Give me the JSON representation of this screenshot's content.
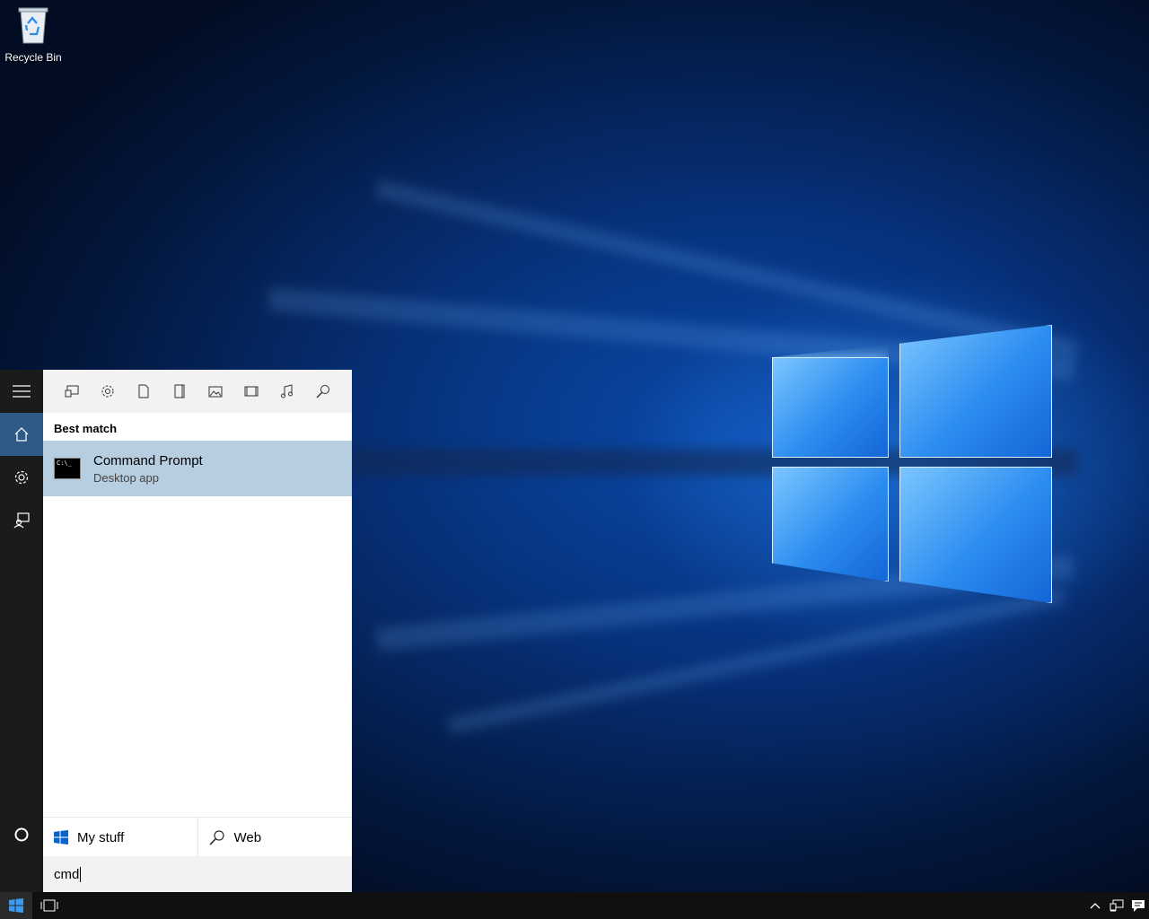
{
  "desktop": {
    "icons": [
      {
        "label": "Recycle Bin",
        "icon": "recycle-bin-icon"
      }
    ]
  },
  "start_rail": {
    "items": [
      {
        "icon": "hamburger-menu-icon"
      },
      {
        "icon": "home-icon",
        "active": true
      },
      {
        "icon": "settings-gear-icon"
      },
      {
        "icon": "feedback-icon"
      }
    ],
    "bottom_icon": "cortana-circle-icon"
  },
  "search_panel": {
    "filters": [
      {
        "icon": "apps-icon"
      },
      {
        "icon": "settings-icon"
      },
      {
        "icon": "documents-icon"
      },
      {
        "icon": "folders-icon"
      },
      {
        "icon": "photos-icon"
      },
      {
        "icon": "videos-icon"
      },
      {
        "icon": "music-icon"
      },
      {
        "icon": "web-search-icon"
      }
    ],
    "section_label": "Best match",
    "best_match": {
      "title": "Command Prompt",
      "subtitle": "Desktop app",
      "icon_text": "C:\\_",
      "icon": "command-prompt-icon"
    },
    "scopes": [
      {
        "label": "My stuff",
        "icon": "windows-logo-icon"
      },
      {
        "label": "Web",
        "icon": "search-icon"
      }
    ],
    "query": "cmd"
  },
  "taskbar": {
    "start_icon": "windows-start-icon",
    "task_view_icon": "task-view-icon",
    "tray": [
      "show-hidden-icons-chevron",
      "network-icon",
      "action-center-icon"
    ]
  },
  "colors": {
    "rail_bg": "#1b1b1b",
    "rail_active": "#2d5a86",
    "result_highlight": "#b7cde0",
    "taskbar_bg": "#101010"
  }
}
